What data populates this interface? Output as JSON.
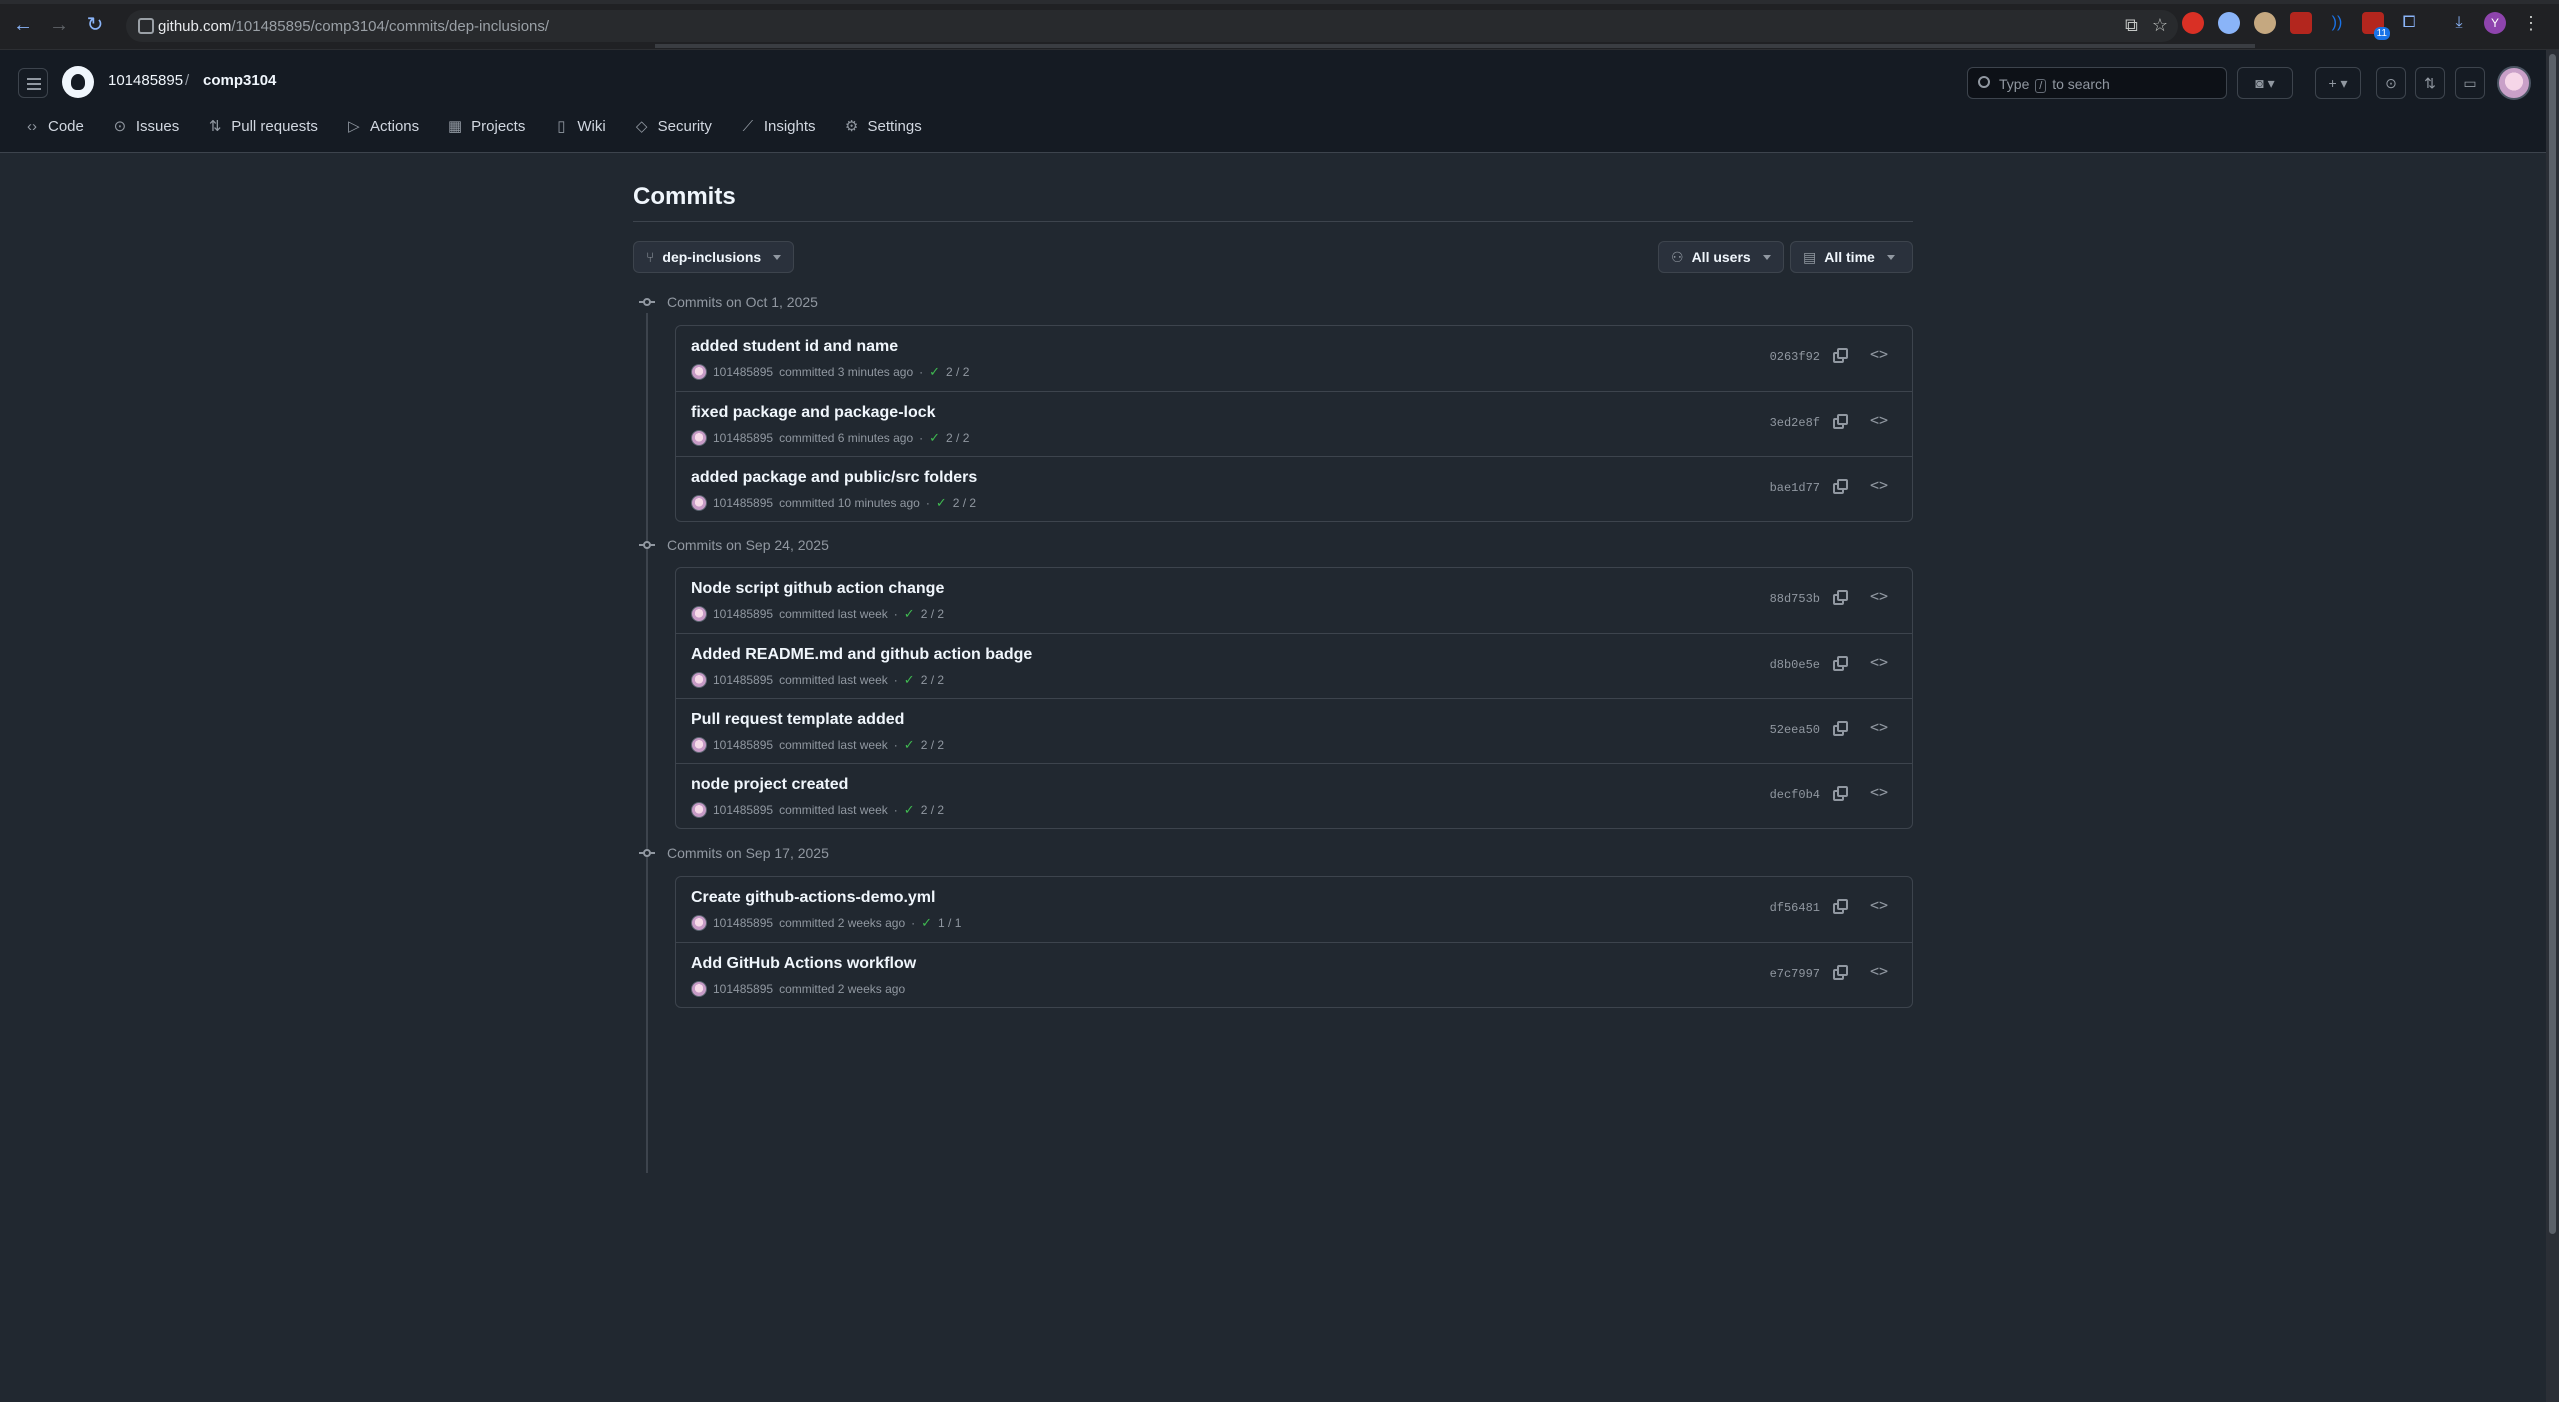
{
  "browser": {
    "url_domain": "github.com",
    "url_path": "/101485895/comp3104/commits/dep-inclusions/",
    "extension_badge": "11",
    "profile_initial": "Y"
  },
  "header": {
    "owner": "101485895",
    "separator": "/",
    "repo": "comp3104",
    "search_prefix": "Type",
    "search_key": "/",
    "search_suffix": "to search"
  },
  "tabs": [
    {
      "label": "Code",
      "icon": "code-icon"
    },
    {
      "label": "Issues",
      "icon": "issue-icon"
    },
    {
      "label": "Pull requests",
      "icon": "pull-request-icon"
    },
    {
      "label": "Actions",
      "icon": "play-icon"
    },
    {
      "label": "Projects",
      "icon": "table-icon"
    },
    {
      "label": "Wiki",
      "icon": "book-icon"
    },
    {
      "label": "Security",
      "icon": "shield-icon"
    },
    {
      "label": "Insights",
      "icon": "graph-icon"
    },
    {
      "label": "Settings",
      "icon": "gear-icon"
    }
  ],
  "page": {
    "title": "Commits",
    "branch": "dep-inclusions",
    "users_filter": "All users",
    "time_filter": "All time"
  },
  "groups": [
    {
      "date": "Commits on Oct 1, 2025",
      "commits": [
        {
          "message": "added student id and name",
          "author": "101485895",
          "when": "committed 3 minutes ago",
          "checks": "2 / 2",
          "sha": "0263f92"
        },
        {
          "message": "fixed package and package-lock",
          "author": "101485895",
          "when": "committed 6 minutes ago",
          "checks": "2 / 2",
          "sha": "3ed2e8f"
        },
        {
          "message": "added package and public/src folders",
          "author": "101485895",
          "when": "committed 10 minutes ago",
          "checks": "2 / 2",
          "sha": "bae1d77"
        }
      ]
    },
    {
      "date": "Commits on Sep 24, 2025",
      "commits": [
        {
          "message": "Node script github action change",
          "author": "101485895",
          "when": "committed last week",
          "checks": "2 / 2",
          "sha": "88d753b"
        },
        {
          "message": "Added README.md and github action badge",
          "author": "101485895",
          "when": "committed last week",
          "checks": "2 / 2",
          "sha": "d8b0e5e"
        },
        {
          "message": "Pull request template added",
          "author": "101485895",
          "when": "committed last week",
          "checks": "2 / 2",
          "sha": "52eea50"
        },
        {
          "message": "node project created",
          "author": "101485895",
          "when": "committed last week",
          "checks": "2 / 2",
          "sha": "decf0b4"
        }
      ]
    },
    {
      "date": "Commits on Sep 17, 2025",
      "commits": [
        {
          "message": "Create github-actions-demo.yml",
          "author": "101485895",
          "when": "committed 2 weeks ago",
          "checks": "1 / 1",
          "sha": "df56481"
        },
        {
          "message": "Add GitHub Actions workflow",
          "author": "101485895",
          "when": "committed 2 weeks ago",
          "checks": "",
          "sha": "e7c7997"
        }
      ]
    }
  ],
  "colors": {
    "background": "#212830",
    "header": "#151b23",
    "border": "#3d444d",
    "success": "#3fb950"
  }
}
